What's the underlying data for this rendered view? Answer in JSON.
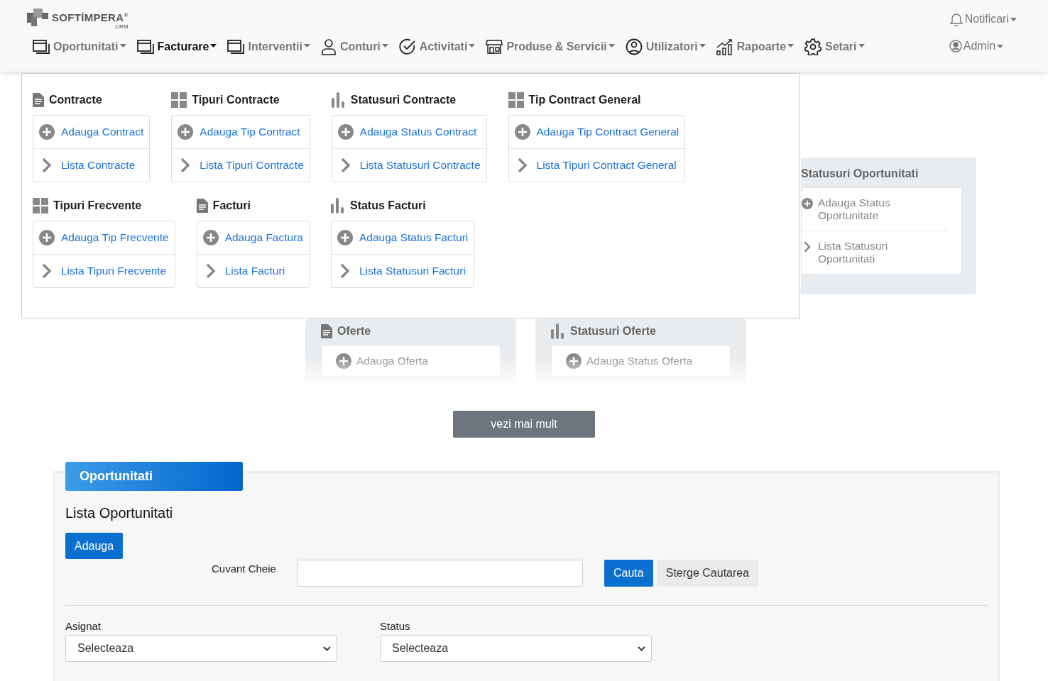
{
  "logo": {
    "name": "SOFTİMPERA$^{®}$",
    "sub": "CRM"
  },
  "nav": [
    {
      "label": "Oportunitati",
      "kind": "window",
      "selected": false
    },
    {
      "label": "Facturare",
      "kind": "window",
      "selected": true
    },
    {
      "label": "Interventii",
      "kind": "window",
      "selected": false
    },
    {
      "label": "Conturi",
      "kind": "user",
      "selected": false
    },
    {
      "label": "Activitati",
      "kind": "check",
      "selected": false
    },
    {
      "label": "Produse & Servicii",
      "kind": "store",
      "selected": false
    },
    {
      "label": "Utilizatori",
      "kind": "user-circle",
      "selected": false
    },
    {
      "label": "Rapoarte",
      "kind": "chart",
      "selected": false
    },
    {
      "label": "Setari",
      "kind": "gear",
      "selected": false
    }
  ],
  "notifications": {
    "label": "Notificari"
  },
  "user_menu": {
    "label": "Admin"
  },
  "dropdown": {
    "rows": [
      [
        {
          "title": "Contracte",
          "kind": "document",
          "items": [
            {
              "kind": "add",
              "label": "Adauga Contract"
            },
            {
              "kind": "list",
              "label": "Lista Contracte"
            }
          ]
        },
        {
          "title": "Tipuri Contracte",
          "kind": "grid",
          "items": [
            {
              "kind": "add",
              "label": "Adauga Tip Contract"
            },
            {
              "kind": "list",
              "label": "Lista Tipuri Contracte"
            }
          ]
        },
        {
          "title": "Statusuri Contracte",
          "kind": "bars",
          "items": [
            {
              "kind": "add",
              "label": "Adauga Status Contract"
            },
            {
              "kind": "list",
              "label": "Lista Statusuri Contracte"
            }
          ]
        },
        {
          "title": "Tip Contract General",
          "kind": "grid",
          "items": [
            {
              "kind": "add",
              "label": "Adauga Tip Contract General"
            },
            {
              "kind": "list",
              "label": "Lista Tipuri Contract General"
            }
          ]
        }
      ],
      [
        {
          "title": "Tipuri Frecvente",
          "kind": "grid",
          "items": [
            {
              "kind": "add",
              "label": "Adauga Tip Frecvente"
            },
            {
              "kind": "list",
              "label": "Lista Tipuri Frecvente"
            }
          ]
        },
        {
          "title": "Facturi",
          "kind": "document",
          "items": [
            {
              "kind": "add",
              "label": "Adauga Factura"
            },
            {
              "kind": "list",
              "label": "Lista Facturi"
            }
          ]
        },
        {
          "title": "Status Facturi",
          "kind": "bars",
          "items": [
            {
              "kind": "add",
              "label": "Adauga Status Facturi"
            },
            {
              "kind": "list",
              "label": "Lista Statusuri Facturi"
            }
          ]
        }
      ]
    ]
  },
  "background_cards": {
    "row_1": [
      {
        "title": "Statusuri Oportunitati",
        "items": [
          {
            "kind": "add",
            "label": "Adauga Status Oportunitate"
          },
          {
            "kind": "list",
            "label": "Lista Statusuri Oportunitati"
          }
        ]
      }
    ],
    "row_2": [
      {
        "title": "Oferte",
        "kind": "document",
        "items": [
          {
            "kind": "add",
            "label": "Adauga Oferta"
          }
        ]
      },
      {
        "title": "Statusuri Oferte",
        "kind": "bars",
        "items": [
          {
            "kind": "add",
            "label": "Adauga Status Oferta"
          }
        ]
      }
    ]
  },
  "more_button": "vezi mai mult",
  "section": {
    "tab": "Oportunitati",
    "title": "Lista Oportunitati",
    "add_button": "Adauga",
    "search": {
      "label": "Cuvant Cheie",
      "search_button": "Cauta",
      "clear_button": "Sterge Cautarea"
    },
    "filters": [
      {
        "label": "Asignat",
        "value": "Selecteaza"
      },
      {
        "label": "Status",
        "value": "Selecteaza"
      }
    ]
  }
}
